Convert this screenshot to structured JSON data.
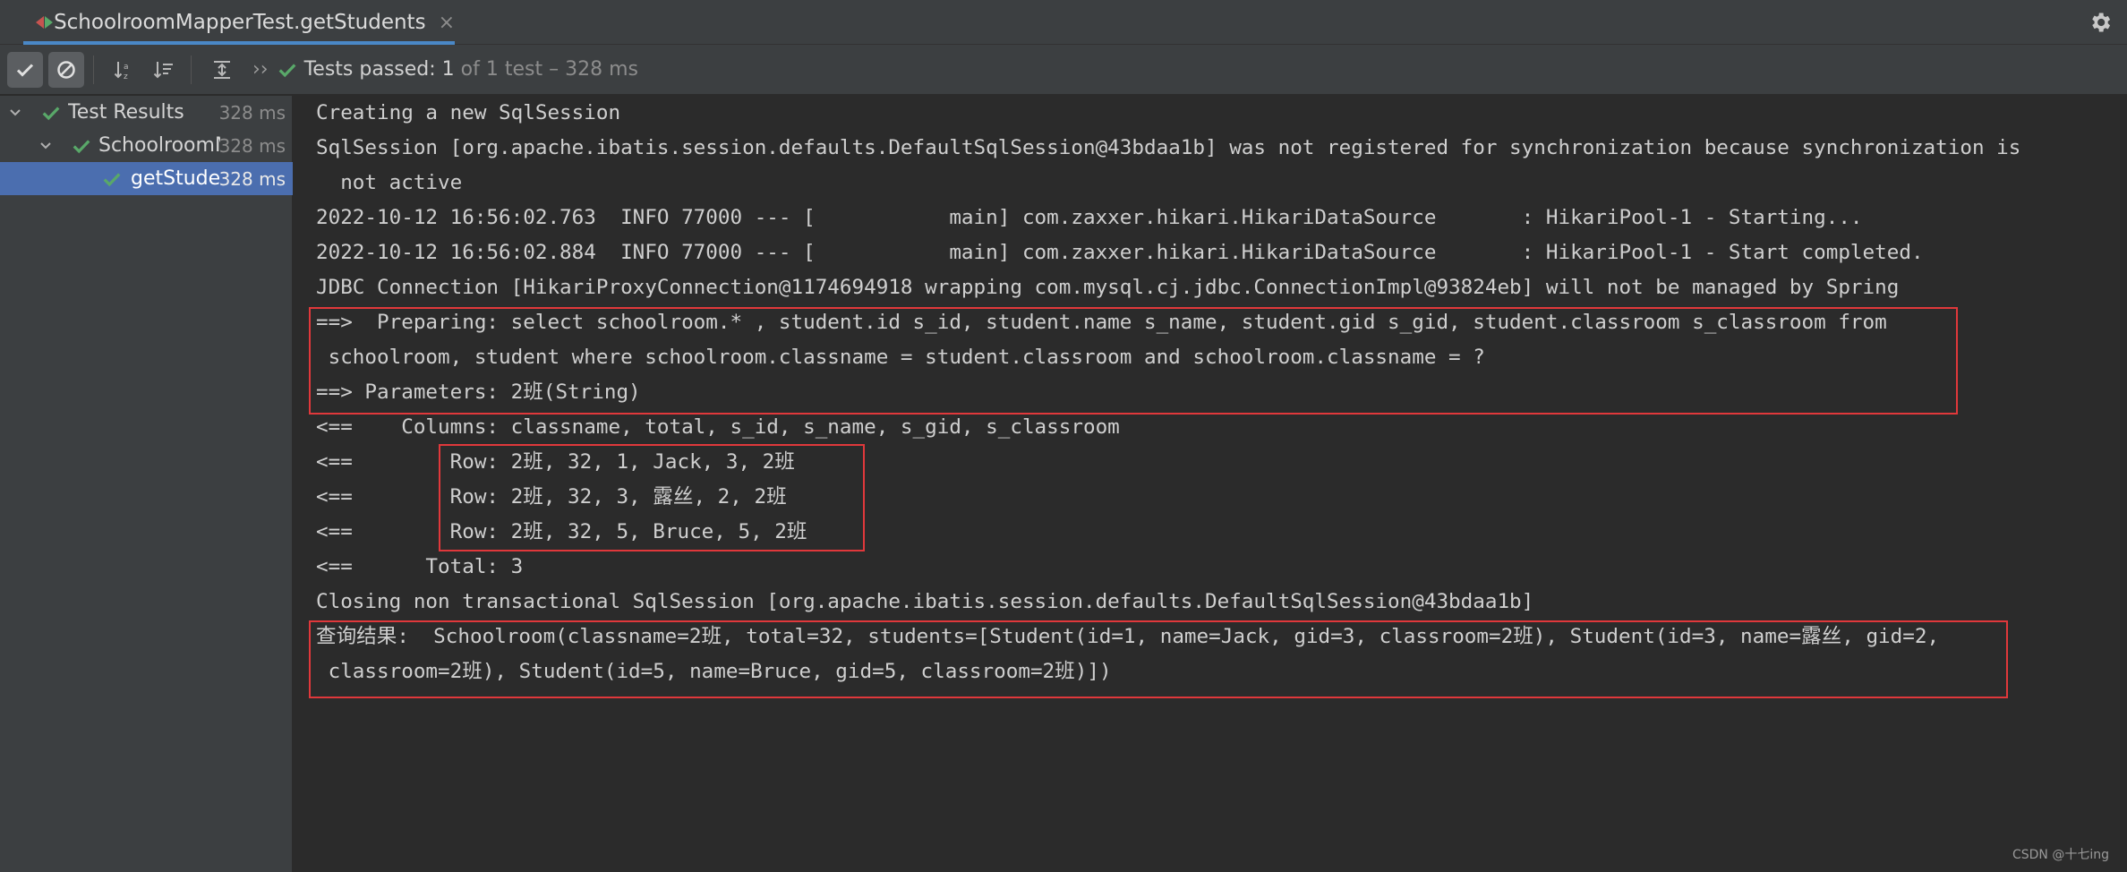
{
  "tab": {
    "title": "SchoolroomMapperTest.getStudents",
    "close": "×"
  },
  "toolbar": {
    "status_passed": "Tests passed: 1",
    "status_rest": " of 1 test – 328 ms",
    "more": "››"
  },
  "tree": [
    {
      "label": "Test Results",
      "time": "328 ms"
    },
    {
      "label": "SchoolroomMapperTest",
      "time": "328 ms"
    },
    {
      "label": "getStudents",
      "time": "328 ms"
    }
  ],
  "console": {
    "lines": [
      "Creating a new SqlSession",
      "SqlSession [org.apache.ibatis.session.defaults.DefaultSqlSession@43bdaa1b] was not registered for synchronization because synchronization is",
      "  not active",
      "2022-10-12 16:56:02.763  INFO 77000 --- [           main] com.zaxxer.hikari.HikariDataSource       : HikariPool-1 - Starting...",
      "2022-10-12 16:56:02.884  INFO 77000 --- [           main] com.zaxxer.hikari.HikariDataSource       : HikariPool-1 - Start completed.",
      "JDBC Connection [HikariProxyConnection@1174694918 wrapping com.mysql.cj.jdbc.ConnectionImpl@93824eb] will not be managed by Spring",
      "==>  Preparing: select schoolroom.* , student.id s_id, student.name s_name, student.gid s_gid, student.classroom s_classroom from",
      " schoolroom, student where schoolroom.classname = student.classroom and schoolroom.classname = ?",
      "==> Parameters: 2班(String)",
      "<==    Columns: classname, total, s_id, s_name, s_gid, s_classroom",
      "<==        Row: 2班, 32, 1, Jack, 3, 2班",
      "<==        Row: 2班, 32, 3, 露丝, 2, 2班",
      "<==        Row: 2班, 32, 5, Bruce, 5, 2班",
      "<==      Total: 3",
      "Closing non transactional SqlSession [org.apache.ibatis.session.defaults.DefaultSqlSession@43bdaa1b]",
      "查询结果:  Schoolroom(classname=2班, total=32, students=[Student(id=1, name=Jack, gid=3, classroom=2班), Student(id=3, name=露丝, gid=2,",
      " classroom=2班), Student(id=5, name=Bruce, gid=5, classroom=2班)])"
    ]
  },
  "watermark": "CSDN @十七ing",
  "colors": {
    "accent": "#4a88c7",
    "pass": "#59a869",
    "highlight_box": "#e0383b",
    "selection": "#4b6eaf"
  }
}
